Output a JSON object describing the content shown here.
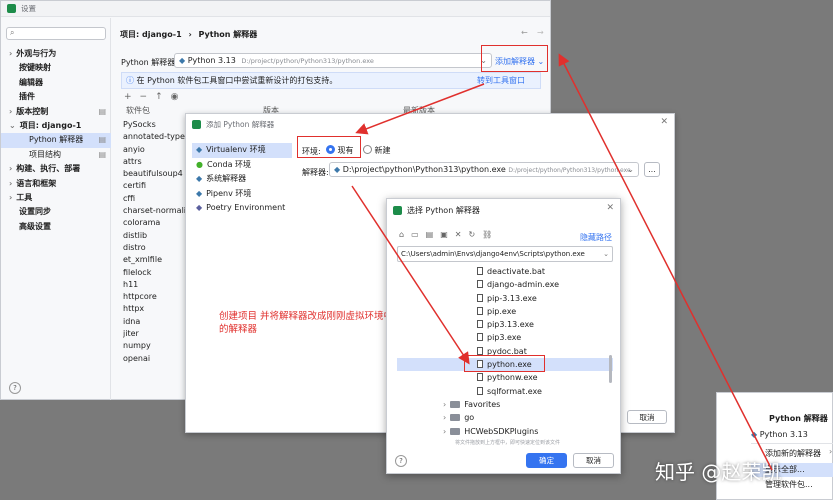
{
  "settings": {
    "title": "设置",
    "search_placeholder": "",
    "nav": [
      "外观与行为",
      "按键映射",
      "编辑器",
      "插件",
      "版本控制",
      "项目: django-1",
      "Python 解释器",
      "项目结构",
      "构建、执行、部署",
      "语言和框架",
      "工具",
      "设置同步",
      "高级设置"
    ],
    "breadcrumb_project": "项目: django-1",
    "breadcrumb_sep": "›",
    "breadcrumb_page": "Python 解释器",
    "interp_label": "Python 解释器:",
    "interp_value": "Python 3.13",
    "interp_path": "D:/project/python/Python313/python.exe",
    "add_interp": "添加解释器",
    "banner_text": "在 Python 软件包工具窗口中尝试重新设计的打包支持。",
    "banner_link": "转到工具窗口",
    "col_package": "软件包",
    "col_version": "版本",
    "col_latest": "最新版本",
    "packages": [
      "PySocks",
      "annotated-types",
      "anyio",
      "attrs",
      "beautifulsoup4",
      "certifi",
      "cffi",
      "charset-normalizer",
      "colorama",
      "distlib",
      "distro",
      "et_xmlfile",
      "filelock",
      "h11",
      "httpcore",
      "httpx",
      "idna",
      "jiter",
      "numpy",
      "openai"
    ],
    "help": "?"
  },
  "add_dialog": {
    "title": "添加 Python 解释器",
    "envs": [
      "Virtualenv 环境",
      "Conda 环境",
      "系统解释器",
      "Pipenv 环境",
      "Poetry Environment"
    ],
    "env_label": "环境:",
    "opt_existing": "现有",
    "opt_new": "新建",
    "interp_label": "解释器:",
    "interp_value": "D:\\project\\python\\Python313\\python.exe",
    "interp_hint": "D:/project/python/Python313/python.exe",
    "browse": "...",
    "cancel": "取消"
  },
  "chooser": {
    "title": "选择 Python 解释器",
    "hide_path": "隐藏路径",
    "path_value": "C:\\Users\\admin\\Envs\\django4env\\Scripts\\python.exe",
    "files": [
      "deactivate.bat",
      "django-admin.exe",
      "pip-3.13.exe",
      "pip.exe",
      "pip3.13.exe",
      "pip3.exe",
      "pydoc.bat",
      "python.exe",
      "pythonw.exe",
      "sqlformat.exe"
    ],
    "selected_index": 7,
    "folders": [
      "Favorites",
      "go",
      "HCWebSDKPlugins"
    ],
    "hint": "将文件拖放到上方框中，即可快速定位到该文件",
    "ok": "确定",
    "cancel": "取消",
    "help": "?"
  },
  "annotation": {
    "text": "创建项目 并将解释器改成刚刚虚拟环境中的解释器",
    "color": "#e0302d"
  },
  "popup": {
    "title": "Python 解释器",
    "current": "Python 3.13",
    "items": [
      "添加新的解释器",
      "显示全部...",
      "管理软件包..."
    ]
  },
  "watermark": "知乎 @赵荣凯"
}
